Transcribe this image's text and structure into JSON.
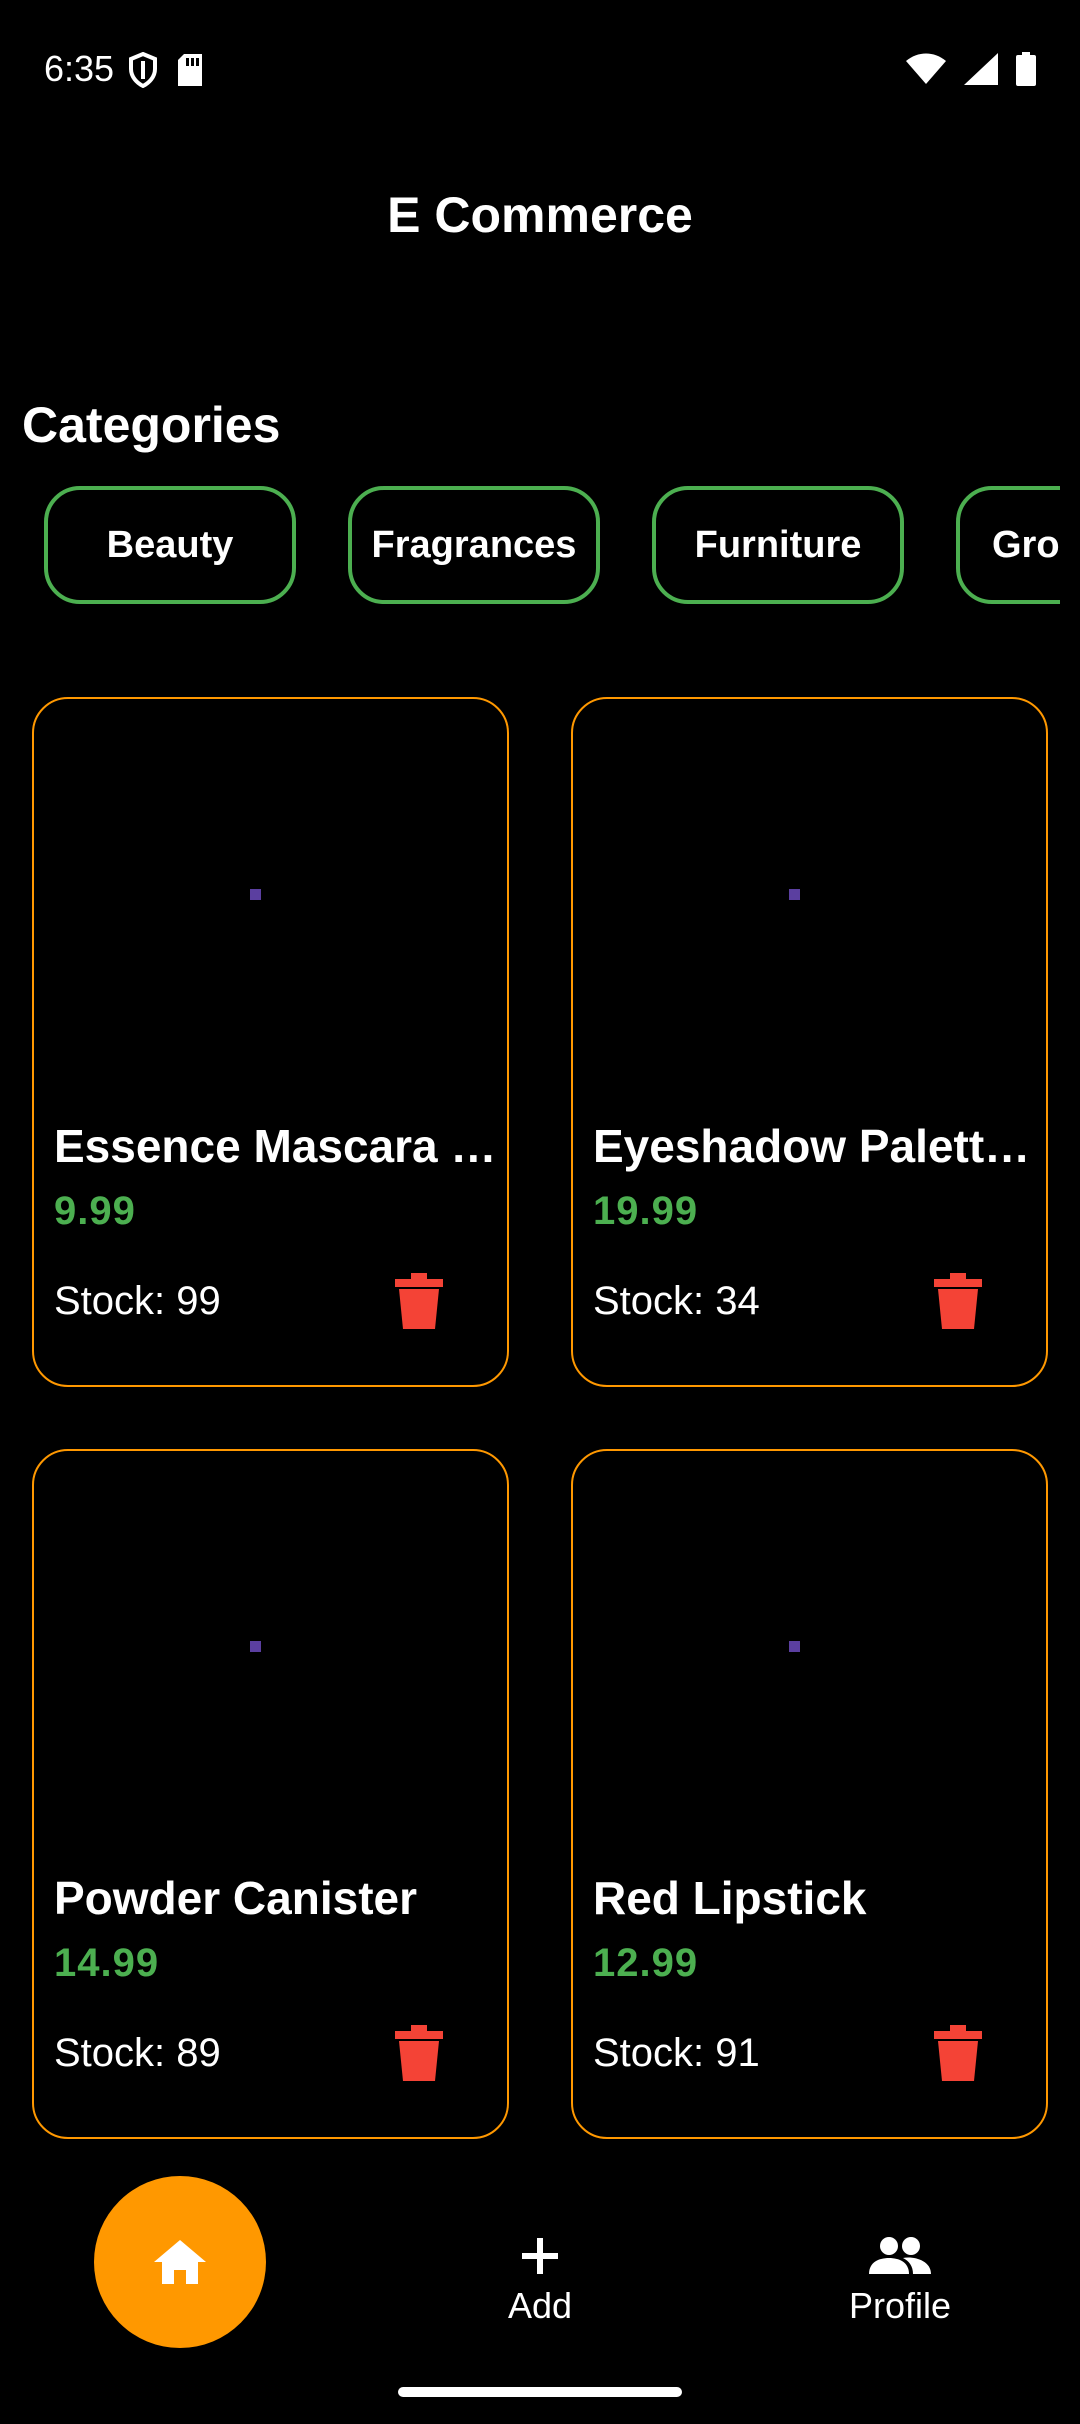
{
  "status_bar": {
    "time": "6:35"
  },
  "app_bar": {
    "title": "E Commerce"
  },
  "categories": {
    "title": "Categories",
    "items": [
      "Beauty",
      "Fragrances",
      "Furniture",
      "Gro"
    ]
  },
  "products": [
    {
      "name": "Essence Mascara …",
      "price": "9.99",
      "stock": "Stock: 99"
    },
    {
      "name": "Eyeshadow Palett…",
      "price": "19.99",
      "stock": "Stock: 34"
    },
    {
      "name": "Powder Canister",
      "price": "14.99",
      "stock": "Stock: 89"
    },
    {
      "name": "Red Lipstick",
      "price": "12.99",
      "stock": "Stock: 91"
    }
  ],
  "bottom_nav": {
    "home_icon": "home-icon",
    "add_label": "Add",
    "profile_label": "Profile"
  },
  "colors": {
    "accent": "#ff9800",
    "chip_border": "#4caf50",
    "price": "#4caf50",
    "delete": "#f44336",
    "background": "#000000"
  }
}
